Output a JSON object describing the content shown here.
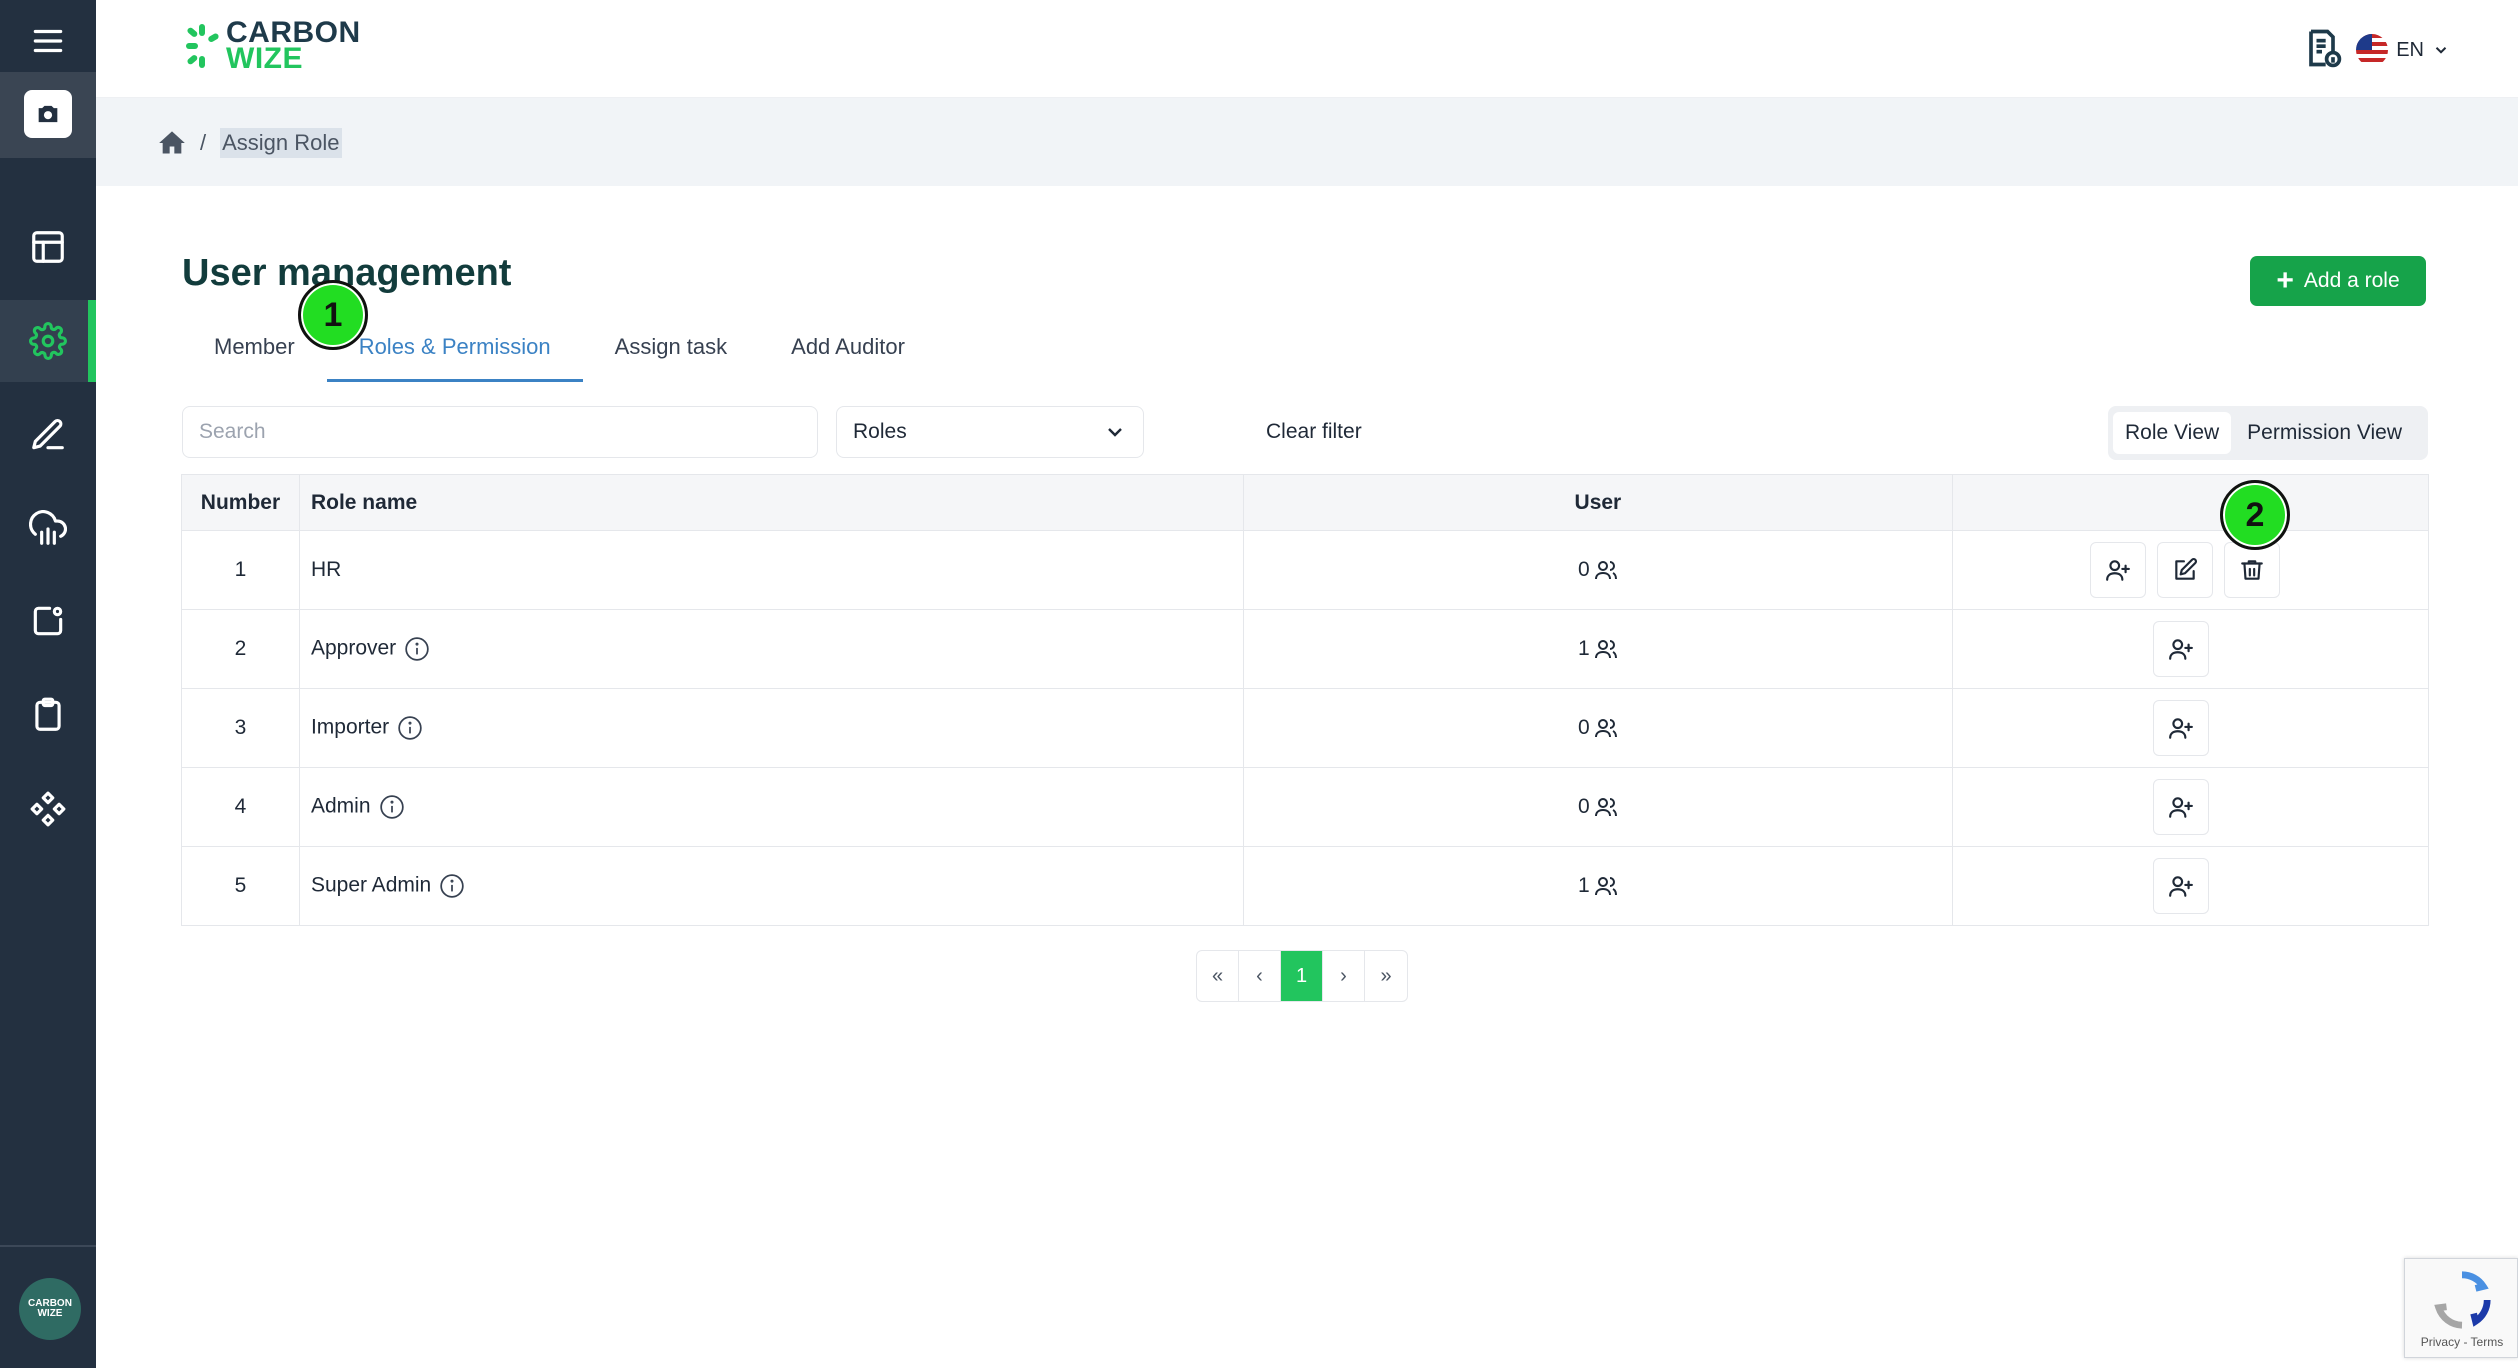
{
  "app": {
    "logo_line1": "CARBON",
    "logo_line2": "WIZE",
    "avatar_line1": "CARBON",
    "avatar_line2": "WIZE",
    "language": "EN"
  },
  "sidebar": {
    "items": [
      {
        "icon": "menu-icon"
      },
      {
        "icon": "camera-icon"
      },
      {
        "icon": "layout-icon"
      },
      {
        "icon": "settings-gear-icon",
        "active": true
      },
      {
        "icon": "edit-pen-icon"
      },
      {
        "icon": "cloud-upload-icon"
      },
      {
        "icon": "notification-square-icon"
      },
      {
        "icon": "clipboard-icon"
      },
      {
        "icon": "components-icon"
      }
    ]
  },
  "breadcrumb": {
    "current": "Assign Role",
    "separator": "/"
  },
  "page": {
    "title": "User management",
    "add_role_label": "Add a role"
  },
  "tabs": [
    {
      "label": "Member",
      "active": false
    },
    {
      "label": "Roles & Permission",
      "active": true
    },
    {
      "label": "Assign task",
      "active": false
    },
    {
      "label": "Add Auditor",
      "active": false
    }
  ],
  "filters": {
    "search_placeholder": "Search",
    "roles_select_value": "Roles",
    "clear_filter_label": "Clear filter",
    "view_toggle": [
      "Role View",
      "Permission View"
    ],
    "active_view": "Role View"
  },
  "table": {
    "headers": [
      "Number",
      "Role name",
      "User",
      ""
    ],
    "rows": [
      {
        "number": "1",
        "role": "HR",
        "users": "0",
        "info": false,
        "actions": [
          "assign-user",
          "edit",
          "delete"
        ]
      },
      {
        "number": "2",
        "role": "Approver",
        "users": "1",
        "info": true,
        "actions": [
          "assign-user"
        ]
      },
      {
        "number": "3",
        "role": "Importer",
        "users": "0",
        "info": true,
        "actions": [
          "assign-user"
        ]
      },
      {
        "number": "4",
        "role": "Admin",
        "users": "0",
        "info": true,
        "actions": [
          "assign-user"
        ]
      },
      {
        "number": "5",
        "role": "Super Admin",
        "users": "1",
        "info": true,
        "actions": [
          "assign-user"
        ]
      }
    ]
  },
  "pagination": {
    "first": "«",
    "prev": "‹",
    "current": "1",
    "next": "›",
    "last": "»"
  },
  "steps": [
    "1",
    "2"
  ],
  "recaptcha": {
    "footer": "Privacy - Terms"
  },
  "colors": {
    "sidebar_bg": "#233040",
    "accent_green": "#22c55e",
    "button_green": "#16a34a",
    "tab_active": "#3b82c4",
    "title_color": "#123c3c"
  }
}
